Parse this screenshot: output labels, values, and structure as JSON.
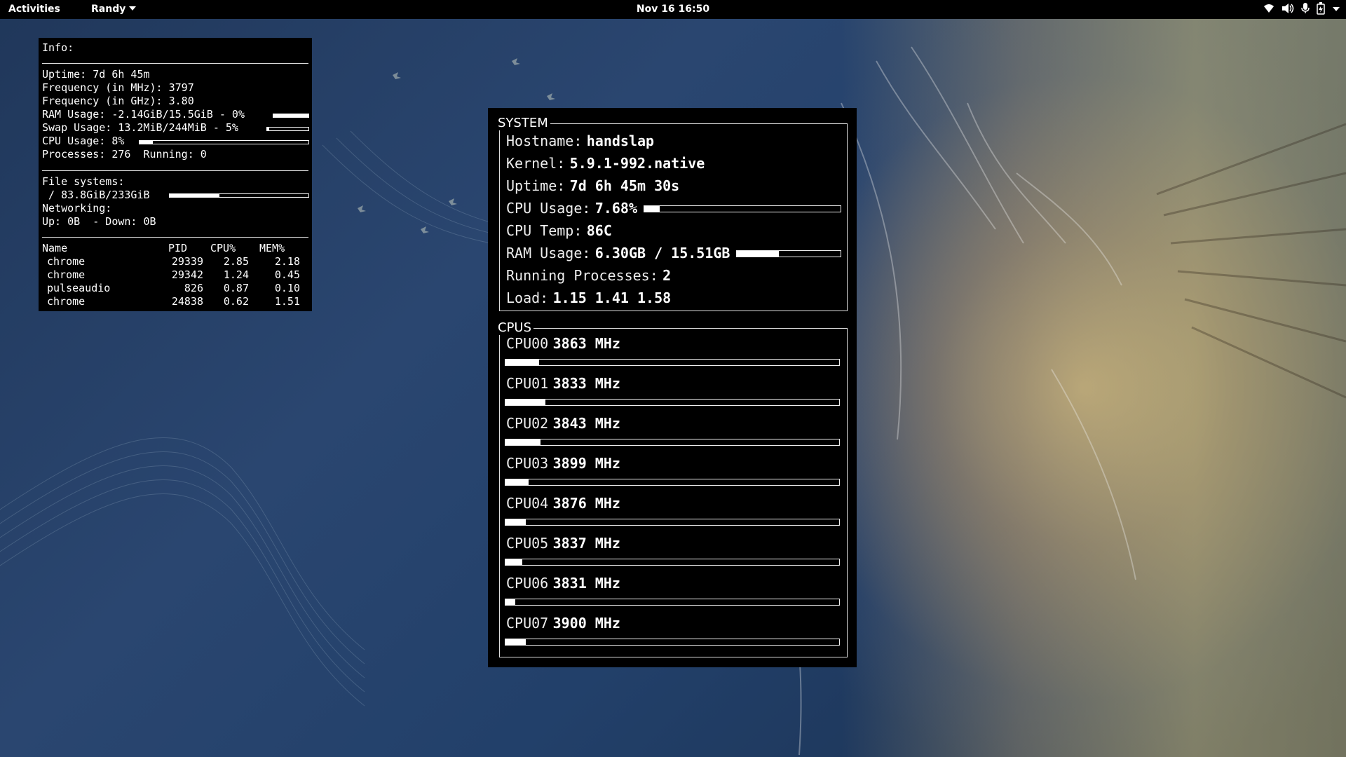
{
  "topbar": {
    "activities": "Activities",
    "user": "Randy",
    "datetime": "Nov 16  16:50",
    "tray_icons": [
      "wifi-icon",
      "volume-icon",
      "microphone-icon",
      "battery-icon",
      "system-menu-arrow-icon"
    ]
  },
  "info_panel": {
    "title": "Info:",
    "uptime_label": "Uptime:",
    "uptime": "7d 6h 45m",
    "freq_mhz_label": "Frequency (in MHz):",
    "freq_mhz": "3797",
    "freq_ghz_label": "Frequency (in GHz):",
    "freq_ghz": "3.80",
    "ram_label": "RAM Usage:",
    "ram": "-2.14GiB/15.5GiB - 0%",
    "ram_fill": 1.0,
    "swap_label": "Swap Usage:",
    "swap": "13.2MiB/244MiB - 5%",
    "swap_fill": 0.05,
    "cpu_label": "CPU Usage:",
    "cpu": "8%",
    "cpu_fill": 0.08,
    "processes_label": "Processes:",
    "processes": "276",
    "running_label": "Running:",
    "running": "0",
    "fs_label": "File systems:",
    "fs_mount": "/",
    "fs": "83.8GiB/233GiB",
    "fs_fill": 0.36,
    "net_label": "Networking:",
    "up_label": "Up:",
    "up": "0B",
    "down_label": "- Down:",
    "down": "0B",
    "table": {
      "headers": [
        "Name",
        "PID",
        "CPU%",
        "MEM%"
      ],
      "rows": [
        [
          "chrome",
          "29339",
          "2.85",
          "2.18"
        ],
        [
          "chrome",
          "29342",
          "1.24",
          "0.45"
        ],
        [
          "pulseaudio",
          "826",
          "0.87",
          "0.10"
        ],
        [
          "chrome",
          "24838",
          "0.62",
          "1.51"
        ]
      ]
    }
  },
  "system_panel": {
    "title": "SYSTEM",
    "hostname_label": "Hostname:",
    "hostname": "handslap",
    "kernel_label": "Kernel:",
    "kernel": "5.9.1-992.native",
    "uptime_label": "Uptime:",
    "uptime": "7d 6h 45m 30s",
    "cpu_label": "CPU Usage:",
    "cpu": "7.68%",
    "cpu_fill": 0.0768,
    "temp_label": "CPU Temp:",
    "temp": "86C",
    "ram_label": "RAM Usage:",
    "ram": "6.30GB / 15.51GB",
    "ram_fill": 0.406,
    "procs_label": "Running Processes:",
    "procs": "2",
    "load_label": "Load:",
    "load": "1.15 1.41 1.58"
  },
  "cpus_panel": {
    "title": "CPUS",
    "cpus": [
      {
        "label": "CPU00",
        "freq": "3863 MHz",
        "fill": 0.1
      },
      {
        "label": "CPU01",
        "freq": "3833 MHz",
        "fill": 0.12
      },
      {
        "label": "CPU02",
        "freq": "3843 MHz",
        "fill": 0.105
      },
      {
        "label": "CPU03",
        "freq": "3899 MHz",
        "fill": 0.07
      },
      {
        "label": "CPU04",
        "freq": "3876 MHz",
        "fill": 0.06
      },
      {
        "label": "CPU05",
        "freq": "3837 MHz",
        "fill": 0.05
      },
      {
        "label": "CPU06",
        "freq": "3831 MHz",
        "fill": 0.03
      },
      {
        "label": "CPU07",
        "freq": "3900 MHz",
        "fill": 0.06
      }
    ]
  }
}
